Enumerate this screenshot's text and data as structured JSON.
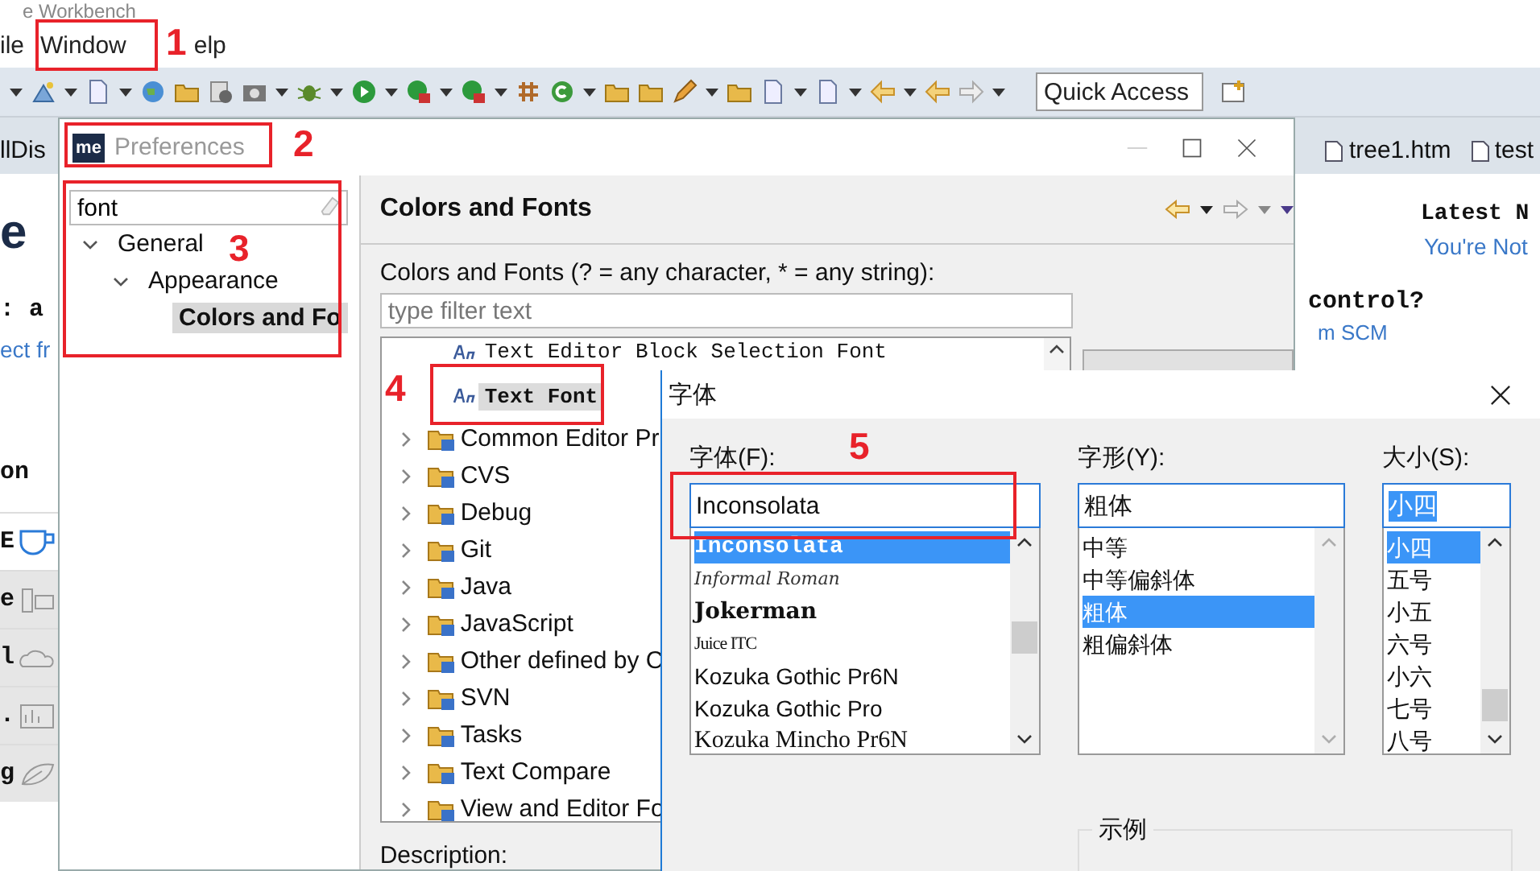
{
  "workbench": {
    "title": "e Workbench",
    "menu": [
      "ile",
      "Window",
      "elp"
    ],
    "quick_access": {
      "placeholder": "Quick Access"
    },
    "editor_tabs": [
      {
        "label": "llDis"
      },
      {
        "label": "tree1.htm"
      },
      {
        "label": "test"
      }
    ],
    "left_texts": [
      "e",
      ": a",
      "ect fr",
      "on"
    ],
    "left_rows": [
      "E",
      "e",
      "l",
      ".",
      "g"
    ],
    "right_texts": [
      "Latest N",
      "You're Not",
      "control?",
      "m SCM"
    ]
  },
  "preferences": {
    "logo_text": "me",
    "title": "Preferences",
    "search": {
      "value": "font"
    },
    "tree": [
      {
        "label": "General",
        "expanded": true,
        "selected": false,
        "children": [
          {
            "label": "Appearance",
            "expanded": true,
            "selected": false,
            "children": [
              {
                "label": "Colors and Fo",
                "selected": true
              }
            ]
          }
        ]
      }
    ],
    "page_title": "Colors and Fonts",
    "filter_label": "Colors and Fonts (? = any character, * = any string):",
    "filter": {
      "placeholder": "type filter text"
    },
    "items": [
      {
        "label": "Text Editor Block Selection Font",
        "kind": "font",
        "selected": false
      },
      {
        "label": "Text Font",
        "kind": "font",
        "selected": true
      },
      {
        "label": "Common Editor Pr",
        "kind": "category",
        "expanded": false,
        "selected": false
      },
      {
        "label": "CVS",
        "kind": "category",
        "expanded": false,
        "selected": false
      },
      {
        "label": "Debug",
        "kind": "category",
        "expanded": false,
        "selected": false
      },
      {
        "label": "Git",
        "kind": "category",
        "expanded": false,
        "selected": false
      },
      {
        "label": "Java",
        "kind": "category",
        "expanded": false,
        "selected": false
      },
      {
        "label": "JavaScript",
        "kind": "category",
        "expanded": false,
        "selected": false
      },
      {
        "label": "Other defined by C",
        "kind": "category",
        "expanded": false,
        "selected": false
      },
      {
        "label": "SVN",
        "kind": "category",
        "expanded": false,
        "selected": false
      },
      {
        "label": "Tasks",
        "kind": "category",
        "expanded": false,
        "selected": false
      },
      {
        "label": "Text Compare",
        "kind": "category",
        "expanded": false,
        "selected": false
      },
      {
        "label": "View and Editor Fo",
        "kind": "category",
        "expanded": false,
        "selected": false
      }
    ],
    "description_label": "Description:"
  },
  "font_dialog": {
    "title": "字体",
    "columns": [
      {
        "label": "字体(F):",
        "value": "Inconsolata",
        "options": [
          {
            "label": "Inconsolata",
            "kind": "mono",
            "selected": true
          },
          {
            "label": "Informal Roman",
            "kind": "script",
            "selected": false
          },
          {
            "label": "Jokerman",
            "kind": "decorative",
            "selected": false
          },
          {
            "label": "Juice ITC",
            "kind": "condensed",
            "selected": false
          },
          {
            "label": "Kozuka Gothic Pr6N",
            "kind": "sans",
            "selected": false
          },
          {
            "label": "Kozuka Gothic Pro",
            "kind": "sans",
            "selected": false
          },
          {
            "label": "Kozuka Mincho Pr6N",
            "kind": "serif",
            "selected": false
          }
        ]
      },
      {
        "label": "字形(Y):",
        "value": "粗体",
        "options": [
          {
            "label": "中等",
            "kind": "sans",
            "selected": false
          },
          {
            "label": "中等偏斜体",
            "kind": "sans",
            "selected": false
          },
          {
            "label": "粗体",
            "kind": "sans",
            "selected": true
          },
          {
            "label": "粗偏斜体",
            "kind": "sans",
            "selected": false
          }
        ]
      },
      {
        "label": "大小(S):",
        "value": "小四",
        "options": [
          {
            "label": "小四",
            "kind": "sans",
            "selected": true
          },
          {
            "label": "五号",
            "kind": "sans",
            "selected": false
          },
          {
            "label": "小五",
            "kind": "sans",
            "selected": false
          },
          {
            "label": "六号",
            "kind": "sans",
            "selected": false
          },
          {
            "label": "小六",
            "kind": "sans",
            "selected": false
          },
          {
            "label": "七号",
            "kind": "sans",
            "selected": false
          },
          {
            "label": "八号",
            "kind": "sans",
            "selected": false
          }
        ]
      }
    ],
    "sample_label": "示例"
  },
  "annotations": [
    {
      "label": "1"
    },
    {
      "label": "2"
    },
    {
      "label": "3"
    },
    {
      "label": "4"
    },
    {
      "label": "5"
    }
  ]
}
